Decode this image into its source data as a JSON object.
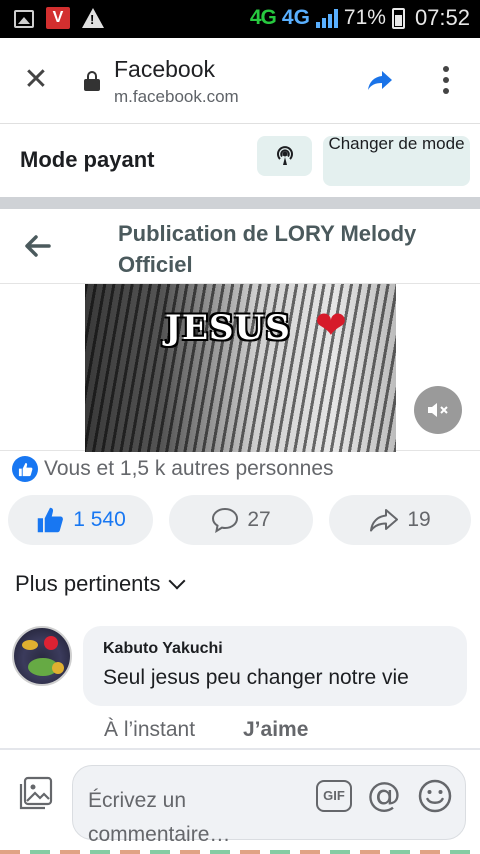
{
  "status_bar": {
    "network_a": "4G",
    "network_b": "4G",
    "battery_percent": "71%",
    "time": "07:52",
    "v_badge": "V",
    "warning_glyph": "!"
  },
  "browser": {
    "site_title": "Facebook",
    "site_url": "m.facebook.com"
  },
  "mode": {
    "title": "Mode payant",
    "change_button": "Changer de mode"
  },
  "post": {
    "header_title": "Publication de LORY Melody Officiel",
    "video_overlay_text": "JESUS",
    "video_overlay_emoji": "❤",
    "reactions_text": "Vous et 1,5 k autres personnes",
    "like_count": "1 540",
    "comment_count": "27",
    "share_count": "19"
  },
  "comments": {
    "sort_label": "Plus pertinents",
    "items": [
      {
        "author": "Kabuto Yakuchi",
        "text": "Seul jesus peu changer notre vie",
        "time": "À l’instant",
        "like_action": "J’aime"
      }
    ]
  },
  "composer": {
    "placeholder": "Écrivez un commentaire…",
    "gif_label": "GIF",
    "at_glyph": "@"
  },
  "colors": {
    "facebook_blue": "#1877f2",
    "pill_bg": "#eef0f2",
    "mode_button_bg": "#e4f0ef",
    "network_green": "#27c93f",
    "network_blue": "#5ab0ff"
  },
  "icons": {
    "close": "close-icon",
    "lock": "lock-icon",
    "share": "share-arrow-icon",
    "menu": "more-vertical-icon",
    "broadcast": "broadcast-icon",
    "back": "back-arrow-icon",
    "mute": "volume-muted-icon",
    "like": "thumbs-up-icon",
    "comment": "comment-bubble-icon",
    "share_post": "share-icon",
    "photo": "photo-icon",
    "emoji": "smiley-icon"
  }
}
